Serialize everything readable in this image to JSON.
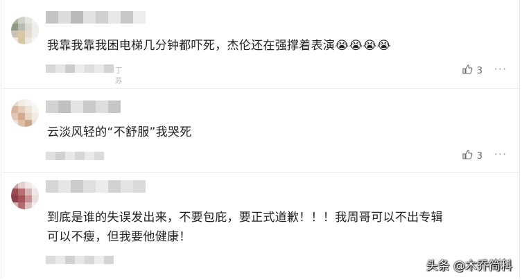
{
  "comments": [
    {
      "text": "我靠我靠我困电梯几分钟都吓死，杰伦还在强撑着表演😭😭😭😭",
      "meta_tail": "丁苏",
      "likes": "3",
      "more": "···"
    },
    {
      "text": "云淡风轻的“不舒服”我哭死",
      "likes": "3",
      "more": "···"
    },
    {
      "text_line1": "到底是谁的失误发出来，不要包庇，要正式道歉！！！我周哥可以不出专辑",
      "text_line2": "可以不瘦，但我要他健康！",
      "more": "···"
    }
  ],
  "watermark": "头条 @木乔简科",
  "icons": {
    "like": "thumbs-up-icon",
    "more": "more-dots-icon"
  }
}
